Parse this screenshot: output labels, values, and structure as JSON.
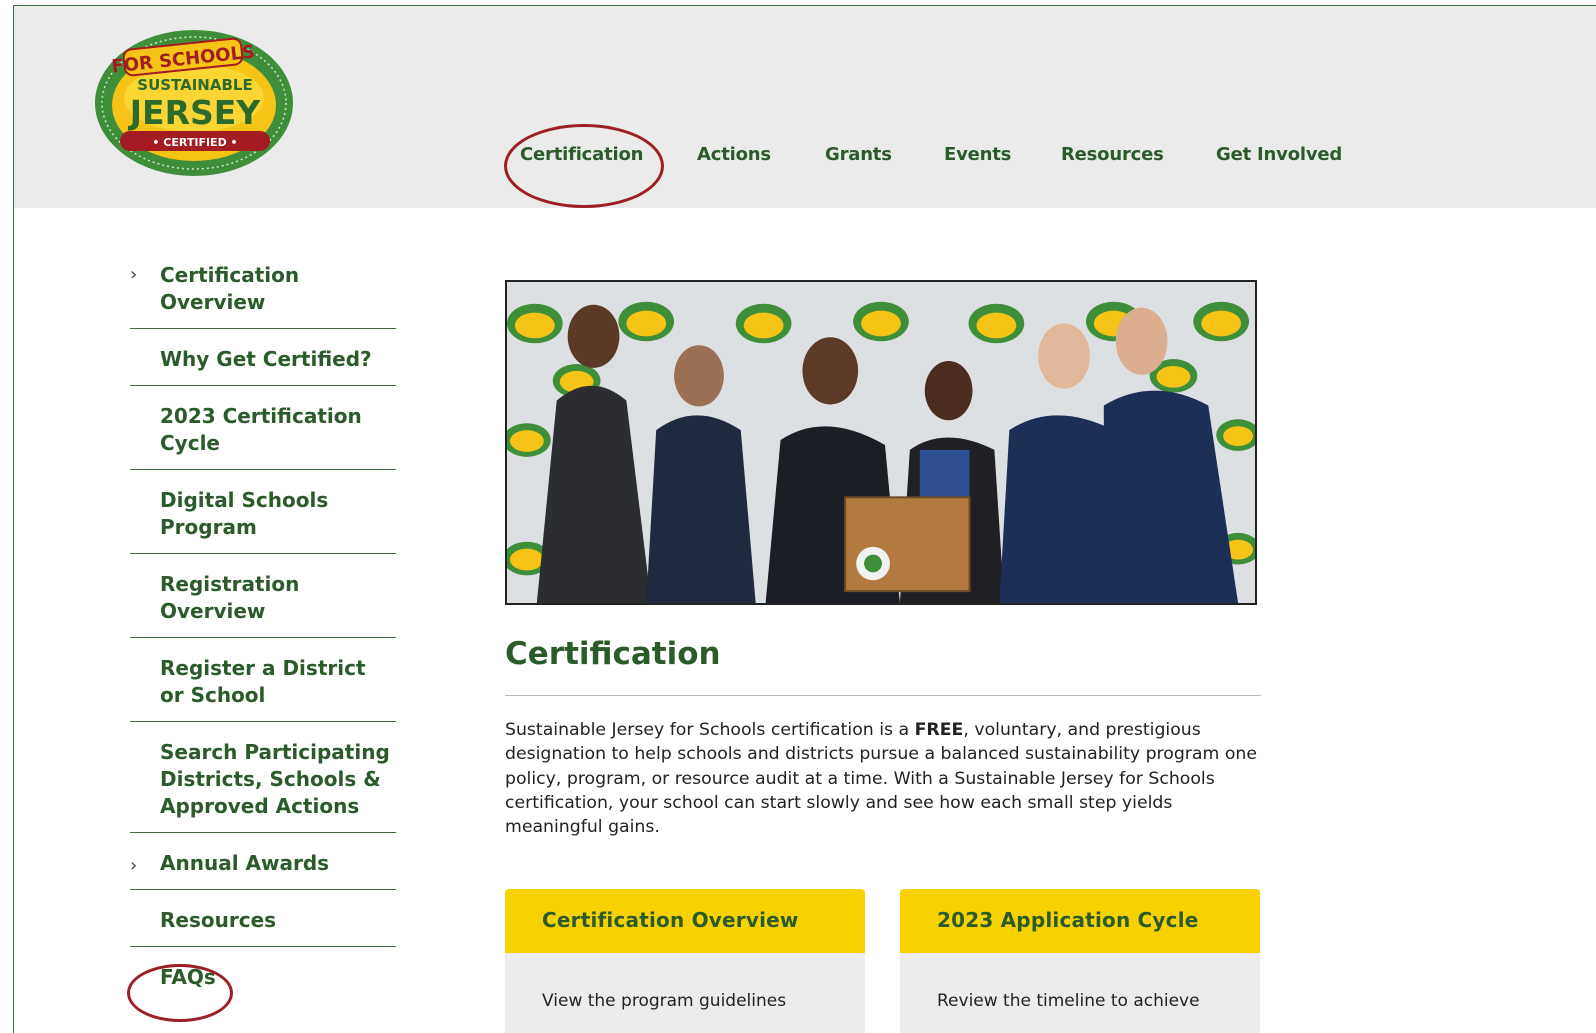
{
  "logo": {
    "top_text": "FOR SCHOOLS",
    "mid_text": "SUSTAINABLE",
    "main_text": "JERSEY",
    "badge_text": "• CERTIFIED •"
  },
  "topnav": {
    "items": [
      {
        "label": "Certification"
      },
      {
        "label": "Actions"
      },
      {
        "label": "Grants"
      },
      {
        "label": "Events"
      },
      {
        "label": "Resources"
      },
      {
        "label": "Get Involved"
      }
    ]
  },
  "sidebar": {
    "items": [
      {
        "label": "Certification Overview",
        "has_chevron": true
      },
      {
        "label": "Why Get Certified?"
      },
      {
        "label": "2023 Certification Cycle"
      },
      {
        "label": "Digital Schools Program"
      },
      {
        "label": "Registration Overview"
      },
      {
        "label": "Register a District or School"
      },
      {
        "label": "Search Participating Districts, Schools & Approved Actions"
      },
      {
        "label": "Annual Awards",
        "has_chevron": true
      },
      {
        "label": "Resources"
      },
      {
        "label": "FAQs"
      }
    ],
    "chevron": "›"
  },
  "main": {
    "title": "Certification",
    "intro_before": "Sustainable Jersey for Schools certification is a ",
    "intro_bold": "FREE",
    "intro_after": ", voluntary, and prestigious designation to help schools and districts pursue a balanced sustainability program one policy, program, or resource audit at a time. With a Sustainable Jersey for Schools certification, your school can start slowly and see how each small step yields meaningful gains."
  },
  "cards": [
    {
      "title": "Certification Overview",
      "body": "View the program guidelines"
    },
    {
      "title": "2023 Application Cycle",
      "body": "Review the timeline to achieve"
    }
  ],
  "colors": {
    "brand_green": "#2b5b2b",
    "accent_yellow": "#f8d200",
    "highlight_red": "#9b1f24",
    "header_gray": "#ebebeb"
  }
}
